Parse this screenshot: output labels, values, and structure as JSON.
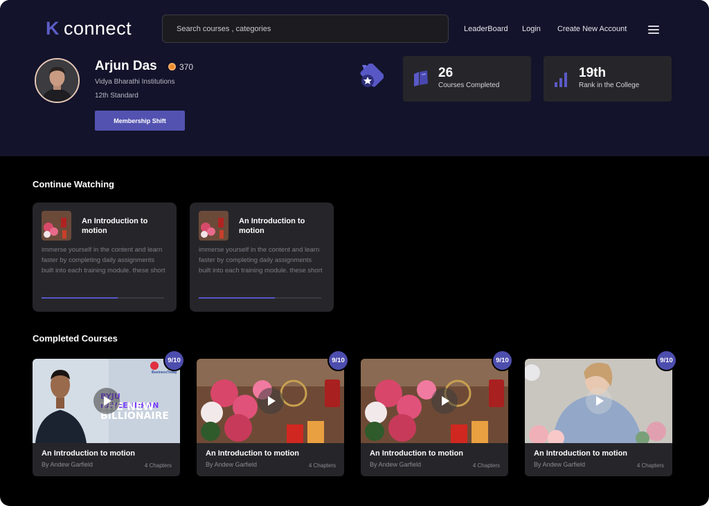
{
  "header": {
    "logo_k": "K",
    "logo_rest": "connect",
    "search_placeholder": "Search  courses , categories",
    "nav": [
      "LeaderBoard",
      "Login",
      "Create New Account"
    ]
  },
  "profile": {
    "name": "Arjun Das",
    "points": "370",
    "institution": "Vidya Bharathi Institutions",
    "standard": "12th Standard",
    "membership_button": "Membership Shift"
  },
  "stats": [
    {
      "value": "26",
      "label": "Courses Completed",
      "icon": "books-icon"
    },
    {
      "value": "19th",
      "label": "Rank in the College",
      "icon": "bar-chart-icon"
    }
  ],
  "continue_watching": {
    "title": "Continue Watching",
    "items": [
      {
        "title": "An Introduction to motion",
        "description": "immerse yourself in the content and learn faster by completing daily assignments built into each training module. these short",
        "progress": 0.62
      },
      {
        "title": "An Introduction to motion",
        "description": "immerse yourself in the content and learn faster by completing daily assignments built into each training module. these short",
        "progress": 0.62
      }
    ]
  },
  "completed_courses": {
    "title": "Completed Courses",
    "items": [
      {
        "title": "An Introduction to motion",
        "author": "By Andew Garfield",
        "chapters": "4 Chapters",
        "score": "9/10",
        "thumb_text1": "BYJU RAVEENDRAN",
        "thumb_text2": "THE NEW",
        "thumb_text3": "BILLIONAIRE",
        "thumb_brand": "BusinessToday"
      },
      {
        "title": "An Introduction to motion",
        "author": "By Andew Garfield",
        "chapters": "4 Chapters",
        "score": "9/10"
      },
      {
        "title": "An Introduction to motion",
        "author": "By Andew Garfield",
        "chapters": "4 Chapters",
        "score": "9/10"
      },
      {
        "title": "An Introduction to motion",
        "author": "By Andew Garfield",
        "chapters": "4 Chapters",
        "score": "9/10"
      }
    ]
  },
  "colors": {
    "accent": "#5352b0",
    "header_bg": "#13132b",
    "card_bg": "#26262a",
    "points": "#f08a2a"
  }
}
